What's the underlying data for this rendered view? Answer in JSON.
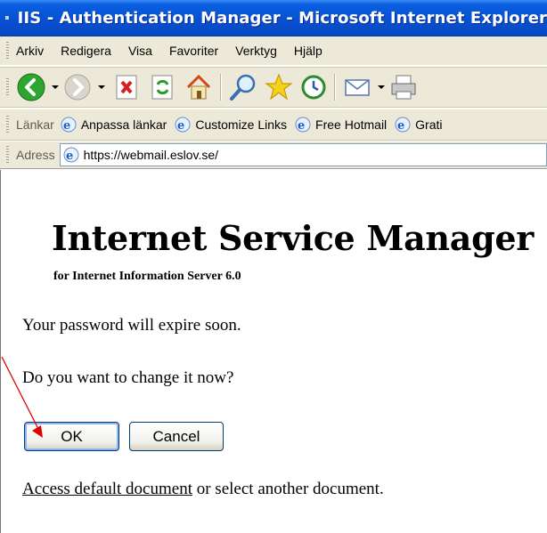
{
  "window": {
    "title": "IIS - Authentication Manager - Microsoft Internet Explorer"
  },
  "menu": {
    "items": [
      "Arkiv",
      "Redigera",
      "Visa",
      "Favoriter",
      "Verktyg",
      "Hjälp"
    ]
  },
  "links_bar": {
    "label": "Länkar",
    "items": [
      "Anpassa länkar",
      "Customize Links",
      "Free Hotmail",
      "Grati"
    ]
  },
  "address_bar": {
    "label": "Adress",
    "url": "https://webmail.eslov.se/"
  },
  "page": {
    "heading": "Internet Service Manager",
    "subheading": "for Internet Information Server 6.0",
    "expire_message": "Your password will expire soon.",
    "change_prompt": "Do you want to change it now?",
    "ok_label": "OK",
    "cancel_label": "Cancel",
    "access_link": "Access default document",
    "access_suffix": " or select another document."
  },
  "annotation": {
    "arrow_color": "#e00000"
  }
}
